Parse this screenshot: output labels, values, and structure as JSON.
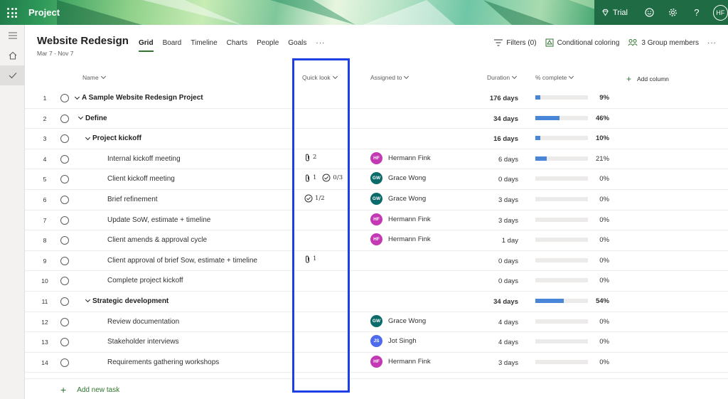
{
  "app": {
    "name": "Project",
    "trial_label": "Trial",
    "user_initials": "HF"
  },
  "project": {
    "title": "Website Redesign",
    "dates": "Mar 7 - Nov 7"
  },
  "tabs": [
    {
      "label": "Grid",
      "active": true
    },
    {
      "label": "Board",
      "active": false
    },
    {
      "label": "Timeline",
      "active": false
    },
    {
      "label": "Charts",
      "active": false
    },
    {
      "label": "People",
      "active": false
    },
    {
      "label": "Goals",
      "active": false
    }
  ],
  "tabs_more": "···",
  "toolbar": {
    "filters": "Filters (0)",
    "conditional": "Conditional coloring",
    "members": "3 Group members",
    "more": "···"
  },
  "columns": {
    "name": "Name",
    "quick_look": "Quick look",
    "assigned_to": "Assigned to",
    "duration": "Duration",
    "percent": "% complete",
    "add_column": "Add column"
  },
  "colors": {
    "accent_green": "#31752f",
    "progress_blue": "#4a86d8",
    "highlight_blue": "#1f3fe6",
    "avatar_hf": "#c239b3",
    "avatar_gw": "#0b6a6a",
    "avatar_js": "#4f6bed"
  },
  "rows": [
    {
      "num": "1",
      "name": "A Sample Website Redesign Project",
      "level": 0,
      "group": true,
      "attachments": "",
      "checklist": "",
      "assignee": "",
      "initials": "",
      "avatar_color": "",
      "duration": "176 days",
      "progress": 9,
      "pct": "9%"
    },
    {
      "num": "2",
      "name": "Define",
      "level": 1,
      "group": true,
      "attachments": "",
      "checklist": "",
      "assignee": "",
      "initials": "",
      "avatar_color": "",
      "duration": "34 days",
      "progress": 46,
      "pct": "46%"
    },
    {
      "num": "3",
      "name": "Project kickoff",
      "level": 2,
      "group": true,
      "attachments": "",
      "checklist": "",
      "assignee": "",
      "initials": "",
      "avatar_color": "",
      "duration": "16 days",
      "progress": 10,
      "pct": "10%"
    },
    {
      "num": "4",
      "name": "Internal kickoff meeting",
      "level": 3,
      "group": false,
      "attachments": "2",
      "checklist": "",
      "assignee": "Hermann Fink",
      "initials": "HF",
      "avatar_color": "#c239b3",
      "duration": "6 days",
      "progress": 21,
      "pct": "21%"
    },
    {
      "num": "5",
      "name": "Client kickoff meeting",
      "level": 3,
      "group": false,
      "attachments": "1",
      "checklist": "0/3",
      "assignee": "Grace Wong",
      "initials": "GW",
      "avatar_color": "#0b6a6a",
      "duration": "0 days",
      "progress": 0,
      "pct": "0%"
    },
    {
      "num": "6",
      "name": "Brief refinement",
      "level": 3,
      "group": false,
      "attachments": "",
      "checklist": "1/2",
      "assignee": "Grace Wong",
      "initials": "GW",
      "avatar_color": "#0b6a6a",
      "duration": "3 days",
      "progress": 0,
      "pct": "0%"
    },
    {
      "num": "7",
      "name": "Update SoW, estimate + timeline",
      "level": 3,
      "group": false,
      "attachments": "",
      "checklist": "",
      "assignee": "Hermann Fink",
      "initials": "HF",
      "avatar_color": "#c239b3",
      "duration": "3 days",
      "progress": 0,
      "pct": "0%"
    },
    {
      "num": "8",
      "name": "Client amends & approval cycle",
      "level": 3,
      "group": false,
      "attachments": "",
      "checklist": "",
      "assignee": "Hermann Fink",
      "initials": "HF",
      "avatar_color": "#c239b3",
      "duration": "1 day",
      "progress": 0,
      "pct": "0%"
    },
    {
      "num": "9",
      "name": "Client approval of brief Sow, estimate + timeline",
      "level": 3,
      "group": false,
      "attachments": "1",
      "checklist": "",
      "assignee": "",
      "initials": "",
      "avatar_color": "",
      "duration": "0 days",
      "progress": 0,
      "pct": "0%"
    },
    {
      "num": "10",
      "name": "Complete project kickoff",
      "level": 3,
      "group": false,
      "attachments": "",
      "checklist": "",
      "assignee": "",
      "initials": "",
      "avatar_color": "",
      "duration": "0 days",
      "progress": 0,
      "pct": "0%"
    },
    {
      "num": "11",
      "name": "Strategic development",
      "level": 2,
      "group": true,
      "attachments": "",
      "checklist": "",
      "assignee": "",
      "initials": "",
      "avatar_color": "",
      "duration": "34 days",
      "progress": 54,
      "pct": "54%"
    },
    {
      "num": "12",
      "name": "Review documentation",
      "level": 3,
      "group": false,
      "attachments": "",
      "checklist": "",
      "assignee": "Grace Wong",
      "initials": "GW",
      "avatar_color": "#0b6a6a",
      "duration": "4 days",
      "progress": 0,
      "pct": "0%"
    },
    {
      "num": "13",
      "name": "Stakeholder interviews",
      "level": 3,
      "group": false,
      "attachments": "",
      "checklist": "",
      "assignee": "Jot Singh",
      "initials": "JS",
      "avatar_color": "#4f6bed",
      "duration": "4 days",
      "progress": 0,
      "pct": "0%"
    },
    {
      "num": "14",
      "name": "Requirements gathering workshops",
      "level": 3,
      "group": false,
      "attachments": "",
      "checklist": "",
      "assignee": "Hermann Fink",
      "initials": "HF",
      "avatar_color": "#c239b3",
      "duration": "3 days",
      "progress": 0,
      "pct": "0%"
    }
  ],
  "add_task_label": "Add new task"
}
